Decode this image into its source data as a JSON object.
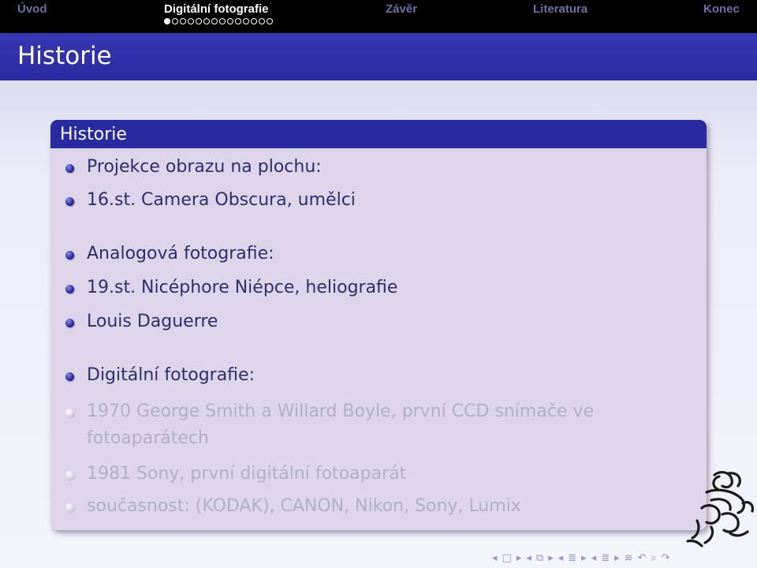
{
  "navbar": {
    "sections": [
      {
        "label": "Úvod",
        "active": false
      },
      {
        "label": "Digitální fotografie",
        "active": true
      },
      {
        "label": "Závěr",
        "active": false
      },
      {
        "label": "Literatura",
        "active": false
      },
      {
        "label": "Konec",
        "active": false
      }
    ],
    "subsection_dots_total": 14,
    "subsection_dots_current": 1
  },
  "frame": {
    "title": "Historie"
  },
  "block": {
    "title": "Historie",
    "items": [
      {
        "text": "Projekce obrazu na plochu:",
        "faded": false
      },
      {
        "text": "16.st. Camera Obscura, umělci",
        "faded": false
      },
      {
        "text": "Analogová fotografie:",
        "faded": false
      },
      {
        "text": "19.st. Nicéphore Niépce, heliografie",
        "faded": false
      },
      {
        "text": "Louis Daguerre",
        "faded": false
      },
      {
        "text": "Digitální fotografie:",
        "faded": false
      },
      {
        "text": "1970 George Smith a Willard Boyle, první CCD snímače ve fotoaparátech",
        "faded": true
      },
      {
        "text": "1981 Sony, první digitální fotoaparát",
        "faded": true
      },
      {
        "text": "současnost: (KODAK), CANON, Nikon, Sony, Lumix",
        "faded": true
      }
    ]
  },
  "colors": {
    "navbar_bg": "#000000",
    "accent_blue": "#2a2aa0",
    "block_body": "#ddd6ea",
    "text": "#2d2d6e",
    "faded_text": "#b4aec8"
  }
}
